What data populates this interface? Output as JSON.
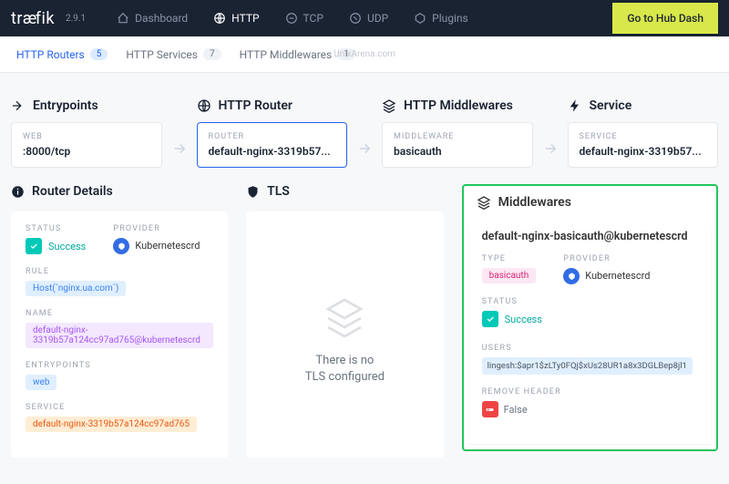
{
  "header": {
    "brand": "træfik",
    "version": "2.9.1",
    "nav": [
      {
        "label": "Dashboard",
        "icon": "dashboard"
      },
      {
        "label": "HTTP",
        "icon": "globe",
        "active": true
      },
      {
        "label": "TCP",
        "icon": "tcp"
      },
      {
        "label": "UDP",
        "icon": "udp"
      },
      {
        "label": "Plugins",
        "icon": "plugin"
      }
    ],
    "hub_button": "Go to Hub Dash"
  },
  "subnav": {
    "items": [
      {
        "label": "HTTP Routers",
        "count": "5",
        "active": true
      },
      {
        "label": "HTTP Services",
        "count": "7"
      },
      {
        "label": "HTTP Middlewares",
        "count": "1"
      }
    ],
    "watermark": "UnixArena.com"
  },
  "flow": {
    "entrypoints": {
      "title": "Entrypoints",
      "card_label": "WEB",
      "card_value": ":8000/tcp"
    },
    "router": {
      "title": "HTTP Router",
      "card_label": "ROUTER",
      "card_value": "default-nginx-3319b57..."
    },
    "middlewares": {
      "title": "HTTP Middlewares",
      "card_label": "MIDDLEWARE",
      "card_value": "basicauth"
    },
    "service": {
      "title": "Service",
      "card_label": "SERVICE",
      "card_value": "default-nginx-3319b57..."
    }
  },
  "router_details": {
    "title": "Router Details",
    "status_label": "STATUS",
    "status_value": "Success",
    "provider_label": "PROVIDER",
    "provider_value": "Kubernetescrd",
    "rule_label": "RULE",
    "rule_value": "Host(`nginx.ua.com`)",
    "name_label": "NAME",
    "name_value": "default-nginx-3319b57a124cc97ad765@kubernetescrd",
    "entrypoints_label": "ENTRYPOINTS",
    "entrypoints_value": "web",
    "service_label": "SERVICE",
    "service_value": "default-nginx-3319b57a124cc97ad765"
  },
  "tls": {
    "title": "TLS",
    "empty_line1": "There is no",
    "empty_line2": "TLS configured"
  },
  "middlewares_panel": {
    "title": "Middlewares",
    "name": "default-nginx-basicauth@kubernetescrd",
    "type_label": "TYPE",
    "type_value": "basicauth",
    "provider_label": "PROVIDER",
    "provider_value": "Kubernetescrd",
    "status_label": "STATUS",
    "status_value": "Success",
    "users_label": "USERS",
    "users_value": "lingesh:$apr1$zLTy0FQj$xUs28UR1a8x3DGLBep8jl1",
    "remove_header_label": "REMOVE HEADER",
    "remove_header_value": "False"
  }
}
